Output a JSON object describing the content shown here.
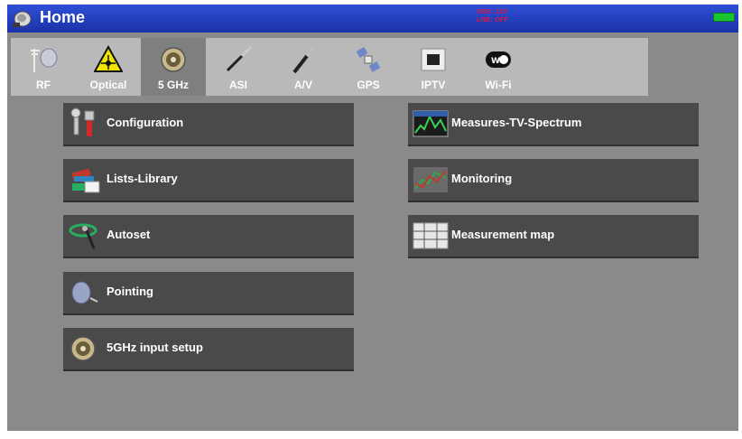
{
  "titlebar": {
    "title": "Home",
    "status_line1": "VBO: 12V",
    "status_line2": "LNB: OFF"
  },
  "tabs": [
    {
      "label": "RF",
      "icon": "antenna-icon",
      "selected": false
    },
    {
      "label": "Optical",
      "icon": "laser-warning-icon",
      "selected": false
    },
    {
      "label": "5 GHz",
      "icon": "connector-icon",
      "selected": true
    },
    {
      "label": "ASI",
      "icon": "asi-cable-icon",
      "selected": false
    },
    {
      "label": "A/V",
      "icon": "av-cable-icon",
      "selected": false
    },
    {
      "label": "GPS",
      "icon": "satellite-icon",
      "selected": false
    },
    {
      "label": "IPTV",
      "icon": "ethernet-port-icon",
      "selected": false
    },
    {
      "label": "Wi-Fi",
      "icon": "wifi-icon",
      "selected": false
    }
  ],
  "menu_left": [
    {
      "label": "Configuration",
      "icon": "tools-icon"
    },
    {
      "label": "Lists-Library",
      "icon": "library-icon"
    },
    {
      "label": "Autoset",
      "icon": "autoset-dish-icon"
    },
    {
      "label": "Pointing",
      "icon": "dish-pointing-icon"
    },
    {
      "label": "5GHz input setup",
      "icon": "connector-icon"
    }
  ],
  "menu_right": [
    {
      "label": "Measures-TV-Spectrum",
      "icon": "spectrum-icon"
    },
    {
      "label": "Monitoring",
      "icon": "monitoring-graph-icon"
    },
    {
      "label": "Measurement map",
      "icon": "map-grid-icon"
    }
  ],
  "colors": {
    "titlebar": "#2443c8",
    "status_text": "#e0183a",
    "battery": "#18c431",
    "button": "#4a4a4a",
    "background": "#8a8a8a"
  }
}
